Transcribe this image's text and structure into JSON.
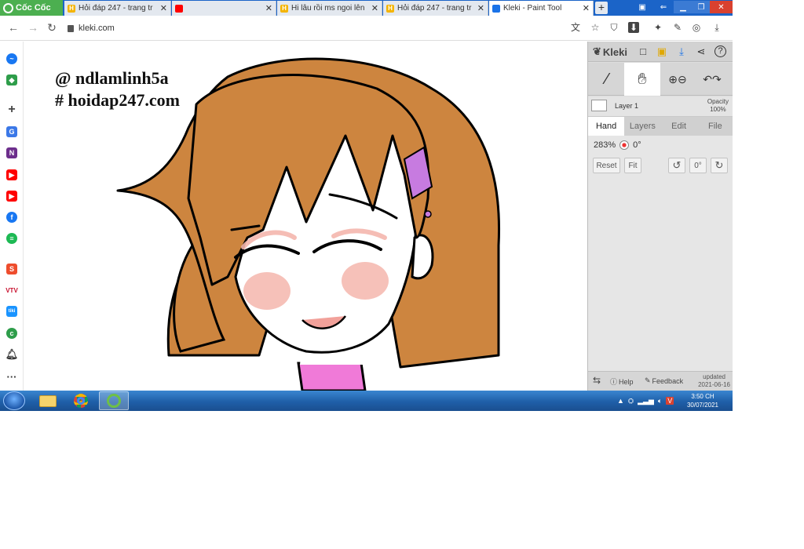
{
  "browser": {
    "brand": "Cốc Cốc",
    "tabs": [
      {
        "title": "Hỏi đáp 247 - trang tr",
        "icon": "hoidap-favicon-icon",
        "active": false
      },
      {
        "title": "",
        "icon": "youtube-icon",
        "active": false
      },
      {
        "title": "Hi lâu rồi ms ngoi lên",
        "icon": "hoidap-favicon-icon",
        "active": false
      },
      {
        "title": "Hỏi đáp 247 - trang tr",
        "icon": "hoidap-favicon-icon",
        "active": false
      },
      {
        "title": "Kleki - Paint Tool",
        "icon": "kleki-favicon-icon",
        "active": true
      }
    ],
    "new_tab": "+",
    "url": "kleki.com"
  },
  "canvas": {
    "watermark_line1": "@ ndlamlinh5a",
    "watermark_line2": "# hoidap247.com",
    "colors": {
      "hair": "#cd853f",
      "blush": "#f4b6ad",
      "pink": "#f07ad8",
      "clip": "#c77be0",
      "skin": "#ffffff",
      "outline": "#000000"
    }
  },
  "kleki": {
    "logo": "Kleki",
    "layer_name": "Layer 1",
    "opacity_label": "Opacity",
    "opacity_value": "100%",
    "tabs": [
      "Hand",
      "Layers",
      "Edit",
      "File"
    ],
    "active_tab": "Hand",
    "zoom": "283%",
    "rotation": "0°",
    "reset_label": "Reset",
    "fit_label": "Fit",
    "rotate_zero_label": "0°",
    "help_label": "Help",
    "feedback_label": "Feedback",
    "updated_label": "updated",
    "updated_date": "2021-06-16"
  },
  "taskbar": {
    "time": "3:50 CH",
    "date": "30/07/2021"
  }
}
